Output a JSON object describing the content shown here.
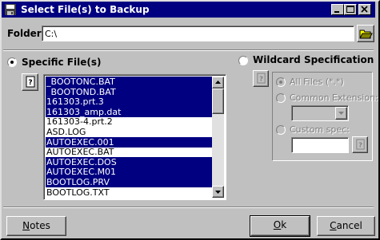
{
  "window": {
    "title": "Select File(s) to Backup"
  },
  "folder": {
    "label": "Folder:",
    "value": "C:\\"
  },
  "specific": {
    "label": "Specific File(s)",
    "selected": true,
    "files": [
      {
        "name": "_BOOTONC.BAT",
        "selected": true
      },
      {
        "name": "_BOOTOND.BAT",
        "selected": true
      },
      {
        "name": "161303.prt.3",
        "selected": true
      },
      {
        "name": "161303_amp.dat",
        "selected": true
      },
      {
        "name": "161303-4.prt.2",
        "selected": false
      },
      {
        "name": "ASD.LOG",
        "selected": false
      },
      {
        "name": "AUTOEXEC.001",
        "selected": true
      },
      {
        "name": "AUTOEXEC.BAT",
        "selected": false
      },
      {
        "name": "AUTOEXEC.DOS",
        "selected": true
      },
      {
        "name": "AUTOEXEC.M01",
        "selected": true
      },
      {
        "name": "BOOTLOG.PRV",
        "selected": true
      },
      {
        "name": "BOOTLOG.TXT",
        "selected": false
      }
    ]
  },
  "wildcard": {
    "label": "Wildcard Specification",
    "selected": false,
    "all_files_label": "All Files (*.*)",
    "common_ext_label": "Common Extension:",
    "common_ext_value": "",
    "custom_spec_label": "Custom spec:",
    "custom_spec_value": ""
  },
  "buttons": {
    "notes": "Notes",
    "ok": "Ok",
    "cancel": "Cancel"
  },
  "icons": {
    "window_icon": "floppy-disk-icon",
    "browse_folder": "open-folder-icon",
    "help_specific": "help-book-icon",
    "help_wildcard": "help-book-icon",
    "help_custom": "help-book-icon"
  }
}
